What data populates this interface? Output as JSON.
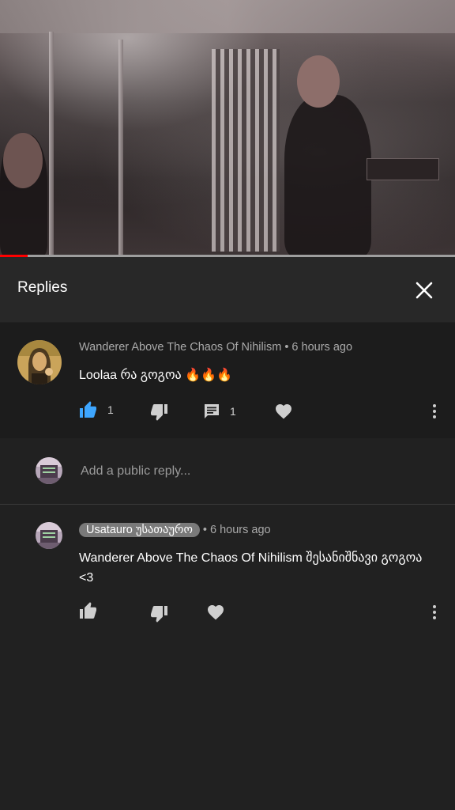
{
  "video": {
    "progress": 0.06
  },
  "header": {
    "title": "Replies",
    "close_icon": "close-icon"
  },
  "parent_comment": {
    "author": "Wanderer Above The Chaos Of Nihilism",
    "separator": "•",
    "time": "6 hours ago",
    "text": "Loolaa რა გოგოა 🔥🔥🔥",
    "likes": "1",
    "replies": "1",
    "liked": true,
    "like_color": "#3ea6ff"
  },
  "reply_box": {
    "placeholder": "Add a public reply..."
  },
  "replies": [
    {
      "author": "Usatauro უსათაურო",
      "separator": "•",
      "time": "6 hours ago",
      "text": "Wanderer Above The Chaos Of Nihilism შესანიშნავი გოგოა <3"
    }
  ]
}
